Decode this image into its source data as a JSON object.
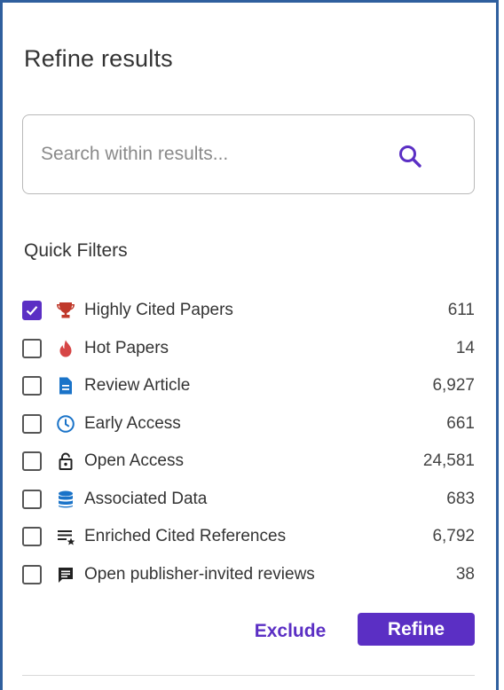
{
  "panel": {
    "title": "Refine results",
    "search": {
      "placeholder": "Search within results...",
      "value": ""
    },
    "quick_filters_title": "Quick Filters",
    "filters": [
      {
        "label": "Highly Cited Papers",
        "count": "611",
        "checked": true,
        "icon": "trophy-icon",
        "icon_color": "#c0392b"
      },
      {
        "label": "Hot Papers",
        "count": "14",
        "checked": false,
        "icon": "flame-icon",
        "icon_color": "#d64545"
      },
      {
        "label": "Review Article",
        "count": "6,927",
        "checked": false,
        "icon": "document-icon",
        "icon_color": "#1a73c8"
      },
      {
        "label": "Early Access",
        "count": "661",
        "checked": false,
        "icon": "clock-icon",
        "icon_color": "#1a73c8"
      },
      {
        "label": "Open Access",
        "count": "24,581",
        "checked": false,
        "icon": "unlock-icon",
        "icon_color": "#222222"
      },
      {
        "label": "Associated Data",
        "count": "683",
        "checked": false,
        "icon": "database-icon",
        "icon_color": "#1a73c8"
      },
      {
        "label": "Enriched Cited References",
        "count": "6,792",
        "checked": false,
        "icon": "enriched-list-icon",
        "icon_color": "#222222"
      },
      {
        "label": "Open publisher-invited reviews",
        "count": "38",
        "checked": false,
        "icon": "comment-icon",
        "icon_color": "#222222"
      }
    ],
    "exclude_label": "Exclude",
    "refine_label": "Refine",
    "accent_color": "#5b2fc4",
    "border_color": "#2f5f9e"
  }
}
